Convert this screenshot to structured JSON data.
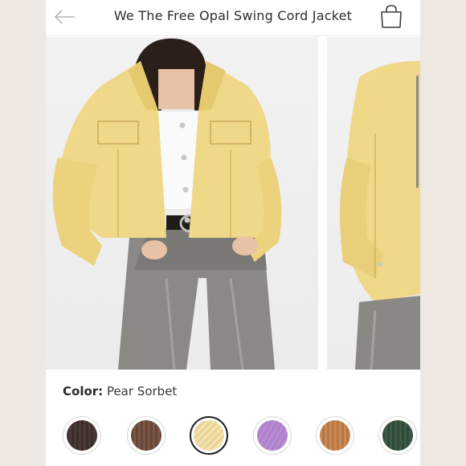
{
  "header": {
    "title": "We The Free Opal Swing Cord Jacket",
    "back_icon": "arrow-left-icon",
    "bag_icon": "shopping-bag-icon"
  },
  "gallery": {
    "images": [
      "model-front-view",
      "model-side-view"
    ]
  },
  "color": {
    "label": "Color:",
    "selected": "Pear Sorbet",
    "swatches": [
      {
        "color": "#3e302c",
        "selected": false
      },
      {
        "color": "#6c4c3c",
        "selected": false
      },
      {
        "color": "#f2dfa6",
        "selected": true
      },
      {
        "color": "#b98ad6",
        "selected": false
      },
      {
        "color": "#c98a55",
        "selected": false
      },
      {
        "color": "#2f4b38",
        "selected": false
      }
    ]
  }
}
